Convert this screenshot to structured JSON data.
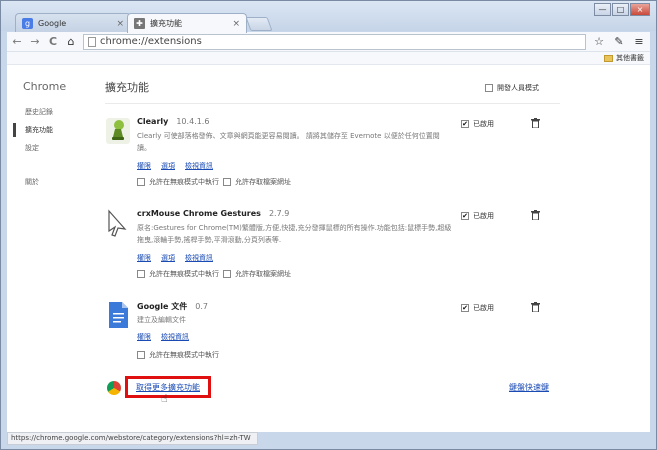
{
  "tabs": [
    {
      "title": "Google",
      "icon": "google-g-icon",
      "icon_color": "#4a7ce8",
      "icon_glyph": "g",
      "close": "×"
    },
    {
      "title": "擴充功能",
      "icon": "puzzle-icon",
      "icon_color": "#666666",
      "icon_glyph": "✚",
      "close": "×"
    }
  ],
  "window_controls": {
    "minimize": "—",
    "maximize": "□",
    "close": "×"
  },
  "toolbar": {
    "back": "←",
    "forward": "→",
    "reload": "C",
    "home": "⌂",
    "url": "chrome://extensions",
    "star": "☆",
    "extension_glyph": "✎",
    "menu": "≡"
  },
  "bookmarks": {
    "other": "其他書籤"
  },
  "sidebar": {
    "brand": "Chrome",
    "items": [
      "歷史記錄",
      "擴充功能",
      "設定"
    ],
    "about": "關於"
  },
  "page": {
    "title": "擴充功能",
    "developer_mode": "開發人員模式"
  },
  "extensions": [
    {
      "name": "Clearly",
      "version": "10.4.1.6",
      "description": "Clearly 可使部落格發佈、文章與網頁能更容易閱讀。 請將其儲存至 Evernote 以便於任何位置閱讀。",
      "links": [
        "權限",
        "選項",
        "檢視資訊"
      ],
      "opt1": "允許在無痕模式中執行",
      "opt2": "允許存取檔案網址",
      "enabled": "已啟用",
      "icon": "clearly-lamp-icon"
    },
    {
      "name": "crxMouse Chrome Gestures",
      "version": "2.7.9",
      "description": "原名:Gestures for Chrome(TM)繁體版,方便,快捷,充分發揮鼠標的所有操作.功能包括:鼠標手勢,超級拖曳,滾輪手勢,搖桿手勢,平滑滾動,分頁列表等.",
      "links": [
        "權限",
        "選項",
        "檢視資訊"
      ],
      "opt1": "允許在無痕模式中執行",
      "opt2": "允許存取檔案網址",
      "enabled": "已啟用",
      "icon": "mouse-cursor-icon"
    },
    {
      "name": "Google 文件",
      "version": "0.7",
      "description": "建立及編輯文件",
      "links": [
        "權限",
        "檢視資訊"
      ],
      "opt1": "允許在無痕模式中執行",
      "enabled": "已啟用",
      "icon": "google-docs-icon"
    }
  ],
  "footer": {
    "get_more": "取得更多擴充功能",
    "shortcuts": "鍵盤快速鍵"
  },
  "status_url": "https://chrome.google.com/webstore/category/extensions?hl=zh-TW"
}
